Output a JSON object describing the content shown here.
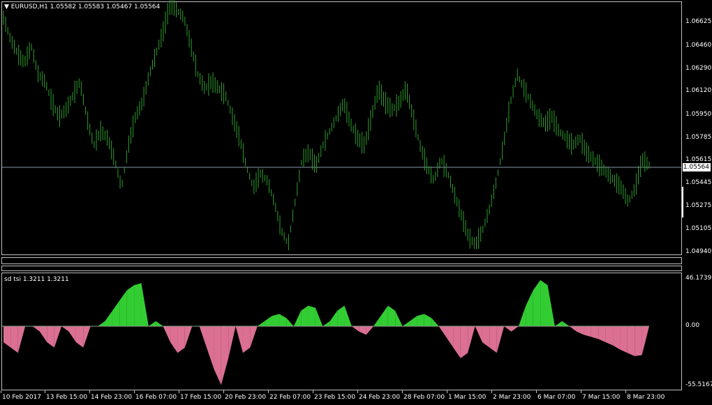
{
  "chart": {
    "symbol_label": "EURUSD,H1",
    "ohlc": "1.05582 1.05583 1.05467 1.05564",
    "current_price": "1.05564",
    "price_labels": [
      "1.06625",
      "1.06460",
      "1.06290",
      "1.06120",
      "1.05950",
      "1.05785",
      "1.05615",
      "1.05445",
      "1.05275",
      "1.05105",
      "1.04940"
    ],
    "bar_color": "#2f9e2f",
    "background": "#000000",
    "grid_color": "#c0c0c0"
  },
  "indicator": {
    "title": "sd tsi 1.3211 1.3211",
    "axis_labels": [
      "46.1739",
      "0.00",
      "-55.5167"
    ],
    "positive_color": "#32cd32",
    "negative_color": "#db7093"
  },
  "time_axis": [
    "10 Feb 2017",
    "13 Feb 15:00",
    "14 Feb 23:00",
    "16 Feb 07:00",
    "17 Feb 15:00",
    "20 Feb 23:00",
    "22 Feb 07:00",
    "23 Feb 15:00",
    "24 Feb 23:00",
    "28 Feb 07:00",
    "1 Mar 15:00",
    "2 Mar 23:00",
    "6 Mar 07:00",
    "7 Mar 15:00",
    "8 Mar 23:00"
  ],
  "chart_data": {
    "type": "bar",
    "title": "EURUSD,H1",
    "ylim": [
      1.0494,
      1.067
    ],
    "price_series_approx": [
      1.066,
      1.0645,
      1.0635,
      1.0628,
      1.064,
      1.062,
      1.0615,
      1.06,
      1.059,
      1.0595,
      1.0605,
      1.0615,
      1.059,
      1.057,
      1.058,
      1.0575,
      1.056,
      1.054,
      1.057,
      1.059,
      1.06,
      1.062,
      1.0635,
      1.065,
      1.067,
      1.0665,
      1.066,
      1.064,
      1.062,
      1.061,
      1.0615,
      1.061,
      1.0605,
      1.059,
      1.0575,
      1.0555,
      1.054,
      1.055,
      1.0545,
      1.053,
      1.051,
      1.05,
      1.053,
      1.056,
      1.0565,
      1.0555,
      1.057,
      1.058,
      1.059,
      1.06,
      1.0585,
      1.0575,
      1.057,
      1.059,
      1.061,
      1.06,
      1.0595,
      1.06,
      1.061,
      1.059,
      1.057,
      1.0555,
      1.0545,
      1.056,
      1.055,
      1.0535,
      1.052,
      1.0505,
      1.05,
      1.051,
      1.0525,
      1.0545,
      1.057,
      1.06,
      1.062,
      1.061,
      1.06,
      1.059,
      1.0585,
      1.059,
      1.058,
      1.0575,
      1.057,
      1.0575,
      1.0565,
      1.056,
      1.0555,
      1.055,
      1.0545,
      1.054,
      1.053,
      1.054,
      1.056,
      1.0556
    ],
    "indicator_series_approx": [
      -15,
      -20,
      -25,
      0,
      0,
      -5,
      -15,
      -20,
      0,
      -5,
      -15,
      -20,
      0,
      0,
      5,
      15,
      25,
      35,
      40,
      42,
      0,
      5,
      0,
      -15,
      -25,
      -20,
      0,
      0,
      -20,
      -40,
      -55,
      -30,
      0,
      -25,
      -20,
      0,
      5,
      10,
      12,
      8,
      0,
      15,
      20,
      18,
      0,
      5,
      15,
      20,
      0,
      -5,
      -8,
      0,
      10,
      20,
      15,
      0,
      5,
      10,
      12,
      8,
      0,
      -10,
      -20,
      -30,
      -25,
      0,
      -15,
      -20,
      -25,
      0,
      -5,
      0,
      20,
      35,
      45,
      40,
      0,
      5,
      0,
      -5,
      -8,
      -10,
      -12,
      -15,
      -18,
      -22,
      -25,
      -28,
      -27,
      0
    ]
  }
}
